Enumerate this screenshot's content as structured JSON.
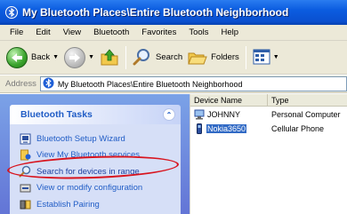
{
  "window": {
    "title": "My Bluetooth Places\\Entire Bluetooth Neighborhood"
  },
  "menu": {
    "items": [
      "File",
      "Edit",
      "View",
      "Bluetooth",
      "Favorites",
      "Tools",
      "Help"
    ]
  },
  "toolbar": {
    "back_label": "Back",
    "search_label": "Search",
    "folders_label": "Folders"
  },
  "address": {
    "label": "Address",
    "value": "My Bluetooth Places\\Entire Bluetooth Neighborhood"
  },
  "tasks": {
    "title": "Bluetooth Tasks",
    "items": [
      {
        "label": "Bluetooth Setup Wizard",
        "icon": "setup-wizard-icon"
      },
      {
        "label": "View My Bluetooth services",
        "icon": "bluetooth-services-icon"
      },
      {
        "label": "Search for devices in range",
        "icon": "search-icon"
      },
      {
        "label": "View or modify configuration",
        "icon": "configuration-icon"
      },
      {
        "label": "Establish Pairing",
        "icon": "pairing-icon"
      }
    ]
  },
  "list": {
    "columns": [
      "Device Name",
      "Type"
    ],
    "rows": [
      {
        "name": "JOHNNY",
        "type": "Personal Computer",
        "icon": "computer-icon",
        "selected": false
      },
      {
        "name": "Nokia3650",
        "type": "Cellular Phone",
        "icon": "phone-icon",
        "selected": true
      }
    ]
  },
  "colors": {
    "title_bar": "#0a56d6",
    "task_link": "#215dc6",
    "highlight_ring": "#d8141e",
    "selection": "#316ac5"
  }
}
